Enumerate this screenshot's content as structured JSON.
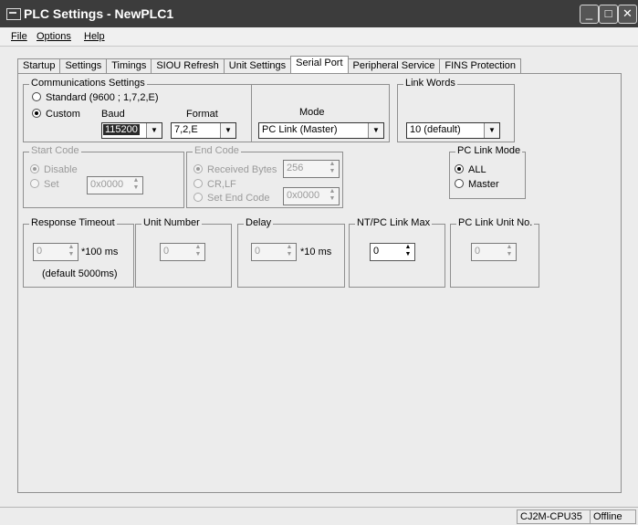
{
  "window": {
    "title": "PLC Settings - NewPLC1",
    "minimize": "_",
    "maximize": "□",
    "close": "✕"
  },
  "menu": {
    "file": "File",
    "options": "Options",
    "help": "Help"
  },
  "tabs": [
    "Startup",
    "Settings",
    "Timings",
    "SIOU Refresh",
    "Unit Settings",
    "Serial Port",
    "Peripheral Service",
    "FINS Protection"
  ],
  "active_tab": "Serial Port",
  "comm": {
    "legend": "Communications Settings",
    "standard_label": "Standard (9600 ; 1,7,2,E)",
    "custom_label": "Custom",
    "baud_label": "Baud",
    "baud_value": "115200",
    "format_label": "Format",
    "format_value": "7,2,E"
  },
  "mode": {
    "label": "Mode",
    "value": "PC Link (Master)"
  },
  "link_words": {
    "legend": "Link Words",
    "value": "10 (default)"
  },
  "start_code": {
    "legend": "Start Code",
    "disable_label": "Disable",
    "set_label": "Set",
    "set_value": "0x0000"
  },
  "end_code": {
    "legend": "End Code",
    "received_label": "Received Bytes",
    "received_value": "256",
    "crlf_label": "CR,LF",
    "set_end_label": "Set End Code",
    "set_end_value": "0x0000"
  },
  "pc_link_mode": {
    "legend": "PC Link Mode",
    "all_label": "ALL",
    "master_label": "Master"
  },
  "response_timeout": {
    "legend": "Response Timeout",
    "value": "0",
    "unit": "*100 ms",
    "note": "(default 5000ms)"
  },
  "unit_number": {
    "legend": "Unit Number",
    "value": "0"
  },
  "delay": {
    "legend": "Delay",
    "value": "0",
    "unit": "*10 ms"
  },
  "nt_pc_link_max": {
    "legend": "NT/PC Link Max",
    "value": "0"
  },
  "pc_link_unit_no": {
    "legend": "PC Link Unit No.",
    "value": "0"
  },
  "status": {
    "cpu": "CJ2M-CPU35",
    "mode": "Offline"
  }
}
